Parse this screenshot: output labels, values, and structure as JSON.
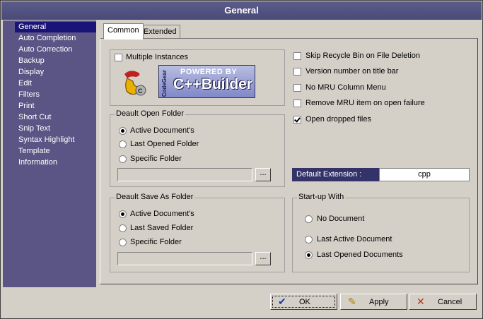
{
  "window": {
    "title": "General"
  },
  "sidebar": {
    "items": [
      {
        "label": "General",
        "active": true
      },
      {
        "label": "Auto Completion"
      },
      {
        "label": "Auto Correction"
      },
      {
        "label": "Backup"
      },
      {
        "label": "Display"
      },
      {
        "label": "Edit"
      },
      {
        "label": "Filters"
      },
      {
        "label": "Print"
      },
      {
        "label": "Short Cut"
      },
      {
        "label": "Snip Text"
      },
      {
        "label": "Syntax Highlight"
      },
      {
        "label": "Template"
      },
      {
        "label": "Information"
      }
    ]
  },
  "tabs": [
    {
      "label": "Common",
      "selected": true
    },
    {
      "label": "Extended"
    }
  ],
  "multiple_instances": {
    "label": "Multiple Instances",
    "checked": false
  },
  "logo": {
    "powered": "POWERED BY",
    "product": "C++Builder",
    "vendor": "CodeGear"
  },
  "open_folder": {
    "title": "Deault Open Folder",
    "options": [
      "Active Document's",
      "Last Opened Folder",
      "Specific Folder"
    ],
    "selected": 0,
    "path": "",
    "browse_label": "..."
  },
  "save_folder": {
    "title": "Deault Save As Folder",
    "options": [
      "Active Document's",
      "Last Saved Folder",
      "Specific Folder"
    ],
    "selected": 0,
    "path": "",
    "browse_label": "..."
  },
  "options": [
    {
      "label": "Skip Recycle Bin on File Deletion",
      "checked": false
    },
    {
      "label": "Version number on title bar",
      "checked": false
    },
    {
      "label": "No MRU Column Menu",
      "checked": false
    },
    {
      "label": "Remove MRU item on open failure",
      "checked": false
    },
    {
      "label": "Open dropped files",
      "checked": true
    }
  ],
  "default_extension": {
    "label": "Default Extension :",
    "value": "cpp"
  },
  "startup": {
    "title": "Start-up With",
    "options": [
      "No Document",
      "Last Active Document",
      "Last Opened Documents"
    ],
    "selected": 2
  },
  "buttons": {
    "ok": "OK",
    "apply": "Apply",
    "cancel": "Cancel"
  },
  "colors": {
    "titlebar": "#4f4f7e",
    "sidebar": "#5a5585",
    "sidebar_active": "#1a1478",
    "default_ext_label_bg": "#33336a"
  }
}
